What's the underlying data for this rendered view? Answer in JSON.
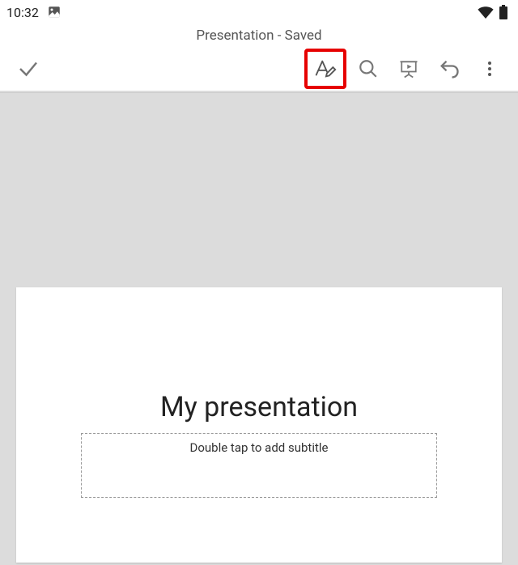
{
  "status": {
    "time": "10:32",
    "icons": {
      "image": "image-icon",
      "wifi": "wifi-icon",
      "battery": "battery-icon"
    }
  },
  "header": {
    "title": "Presentation - Saved"
  },
  "toolbar": {
    "done": "Done",
    "edit": "Edit text",
    "search": "Search",
    "present": "Present",
    "undo": "Undo",
    "more": "More"
  },
  "slide": {
    "title": "My presentation",
    "subtitle_placeholder": "Double tap to add subtitle"
  }
}
